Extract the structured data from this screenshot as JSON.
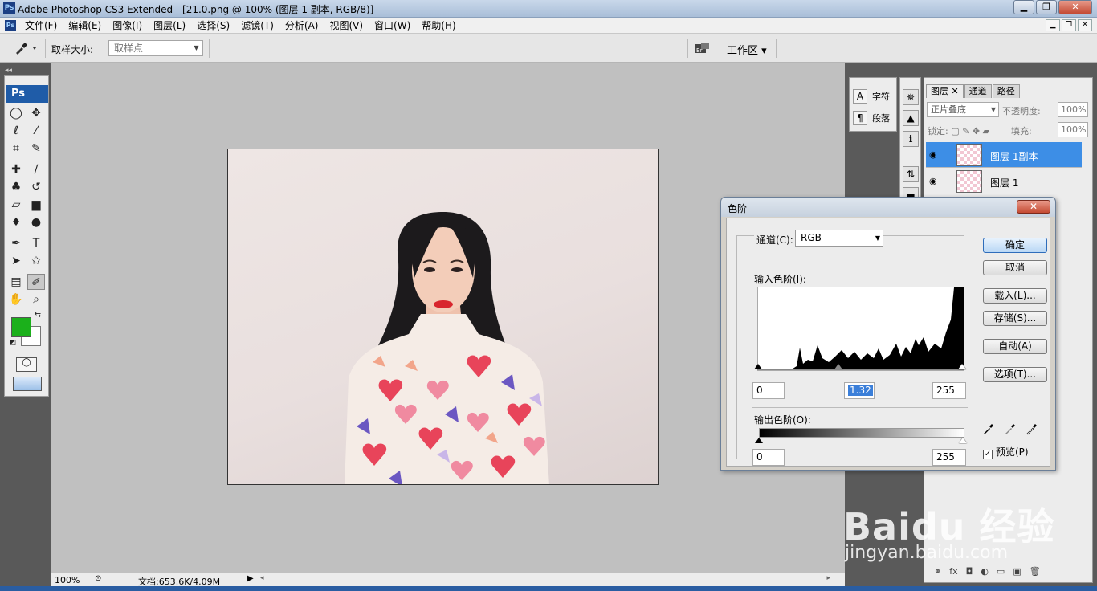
{
  "window": {
    "app_icon": "Ps",
    "title": "Adobe Photoshop CS3 Extended - [21.0.png @ 100% (图层 1 副本, RGB/8)]",
    "minimize": "▁",
    "maximize": "❐",
    "close": "✕"
  },
  "menu": {
    "items": [
      "文件(F)",
      "编辑(E)",
      "图像(I)",
      "图层(L)",
      "选择(S)",
      "滤镜(T)",
      "分析(A)",
      "视图(V)",
      "窗口(W)",
      "帮助(H)"
    ],
    "doc_controls": [
      "▁",
      "❐",
      "✕"
    ]
  },
  "options": {
    "sample_size_label": "取样大小:",
    "sample_size_value": "取样点",
    "workspace_label": "工作区 ▾"
  },
  "toolbox": {
    "header": "Ps",
    "foreground_color": "#1bb01b",
    "background_color": "#ffffff"
  },
  "status": {
    "zoom": "100%",
    "doc_size": "文档:653.6K/4.09M"
  },
  "panels": {
    "character_label": "字符",
    "paragraph_label": "段落",
    "tabs": [
      "图层",
      "通道",
      "路径"
    ],
    "blend_mode": "正片叠底",
    "opacity_label": "不透明度:",
    "opacity_value": "100%",
    "lock_label": "锁定:",
    "fill_label": "填充:",
    "fill_value": "100%",
    "layers": [
      {
        "name": "图层 1副本",
        "selected": true
      },
      {
        "name": "图层 1",
        "selected": false
      }
    ]
  },
  "levels": {
    "title": "色阶",
    "close": "✕",
    "channel_label": "通道(C):",
    "channel_value": "RGB",
    "input_label": "输入色阶(I):",
    "input_black": "0",
    "input_gamma": "1.32",
    "input_white": "255",
    "output_label": "输出色阶(O):",
    "output_black": "0",
    "output_white": "255",
    "ok": "确定",
    "cancel": "取消",
    "load": "载入(L)...",
    "save": "存储(S)...",
    "auto": "自动(A)",
    "options": "选项(T)...",
    "preview_label": "预览(P)",
    "preview_checked": true
  },
  "watermark": {
    "brand": "Baidu 经验",
    "url": "jingyan.baidu.com"
  }
}
